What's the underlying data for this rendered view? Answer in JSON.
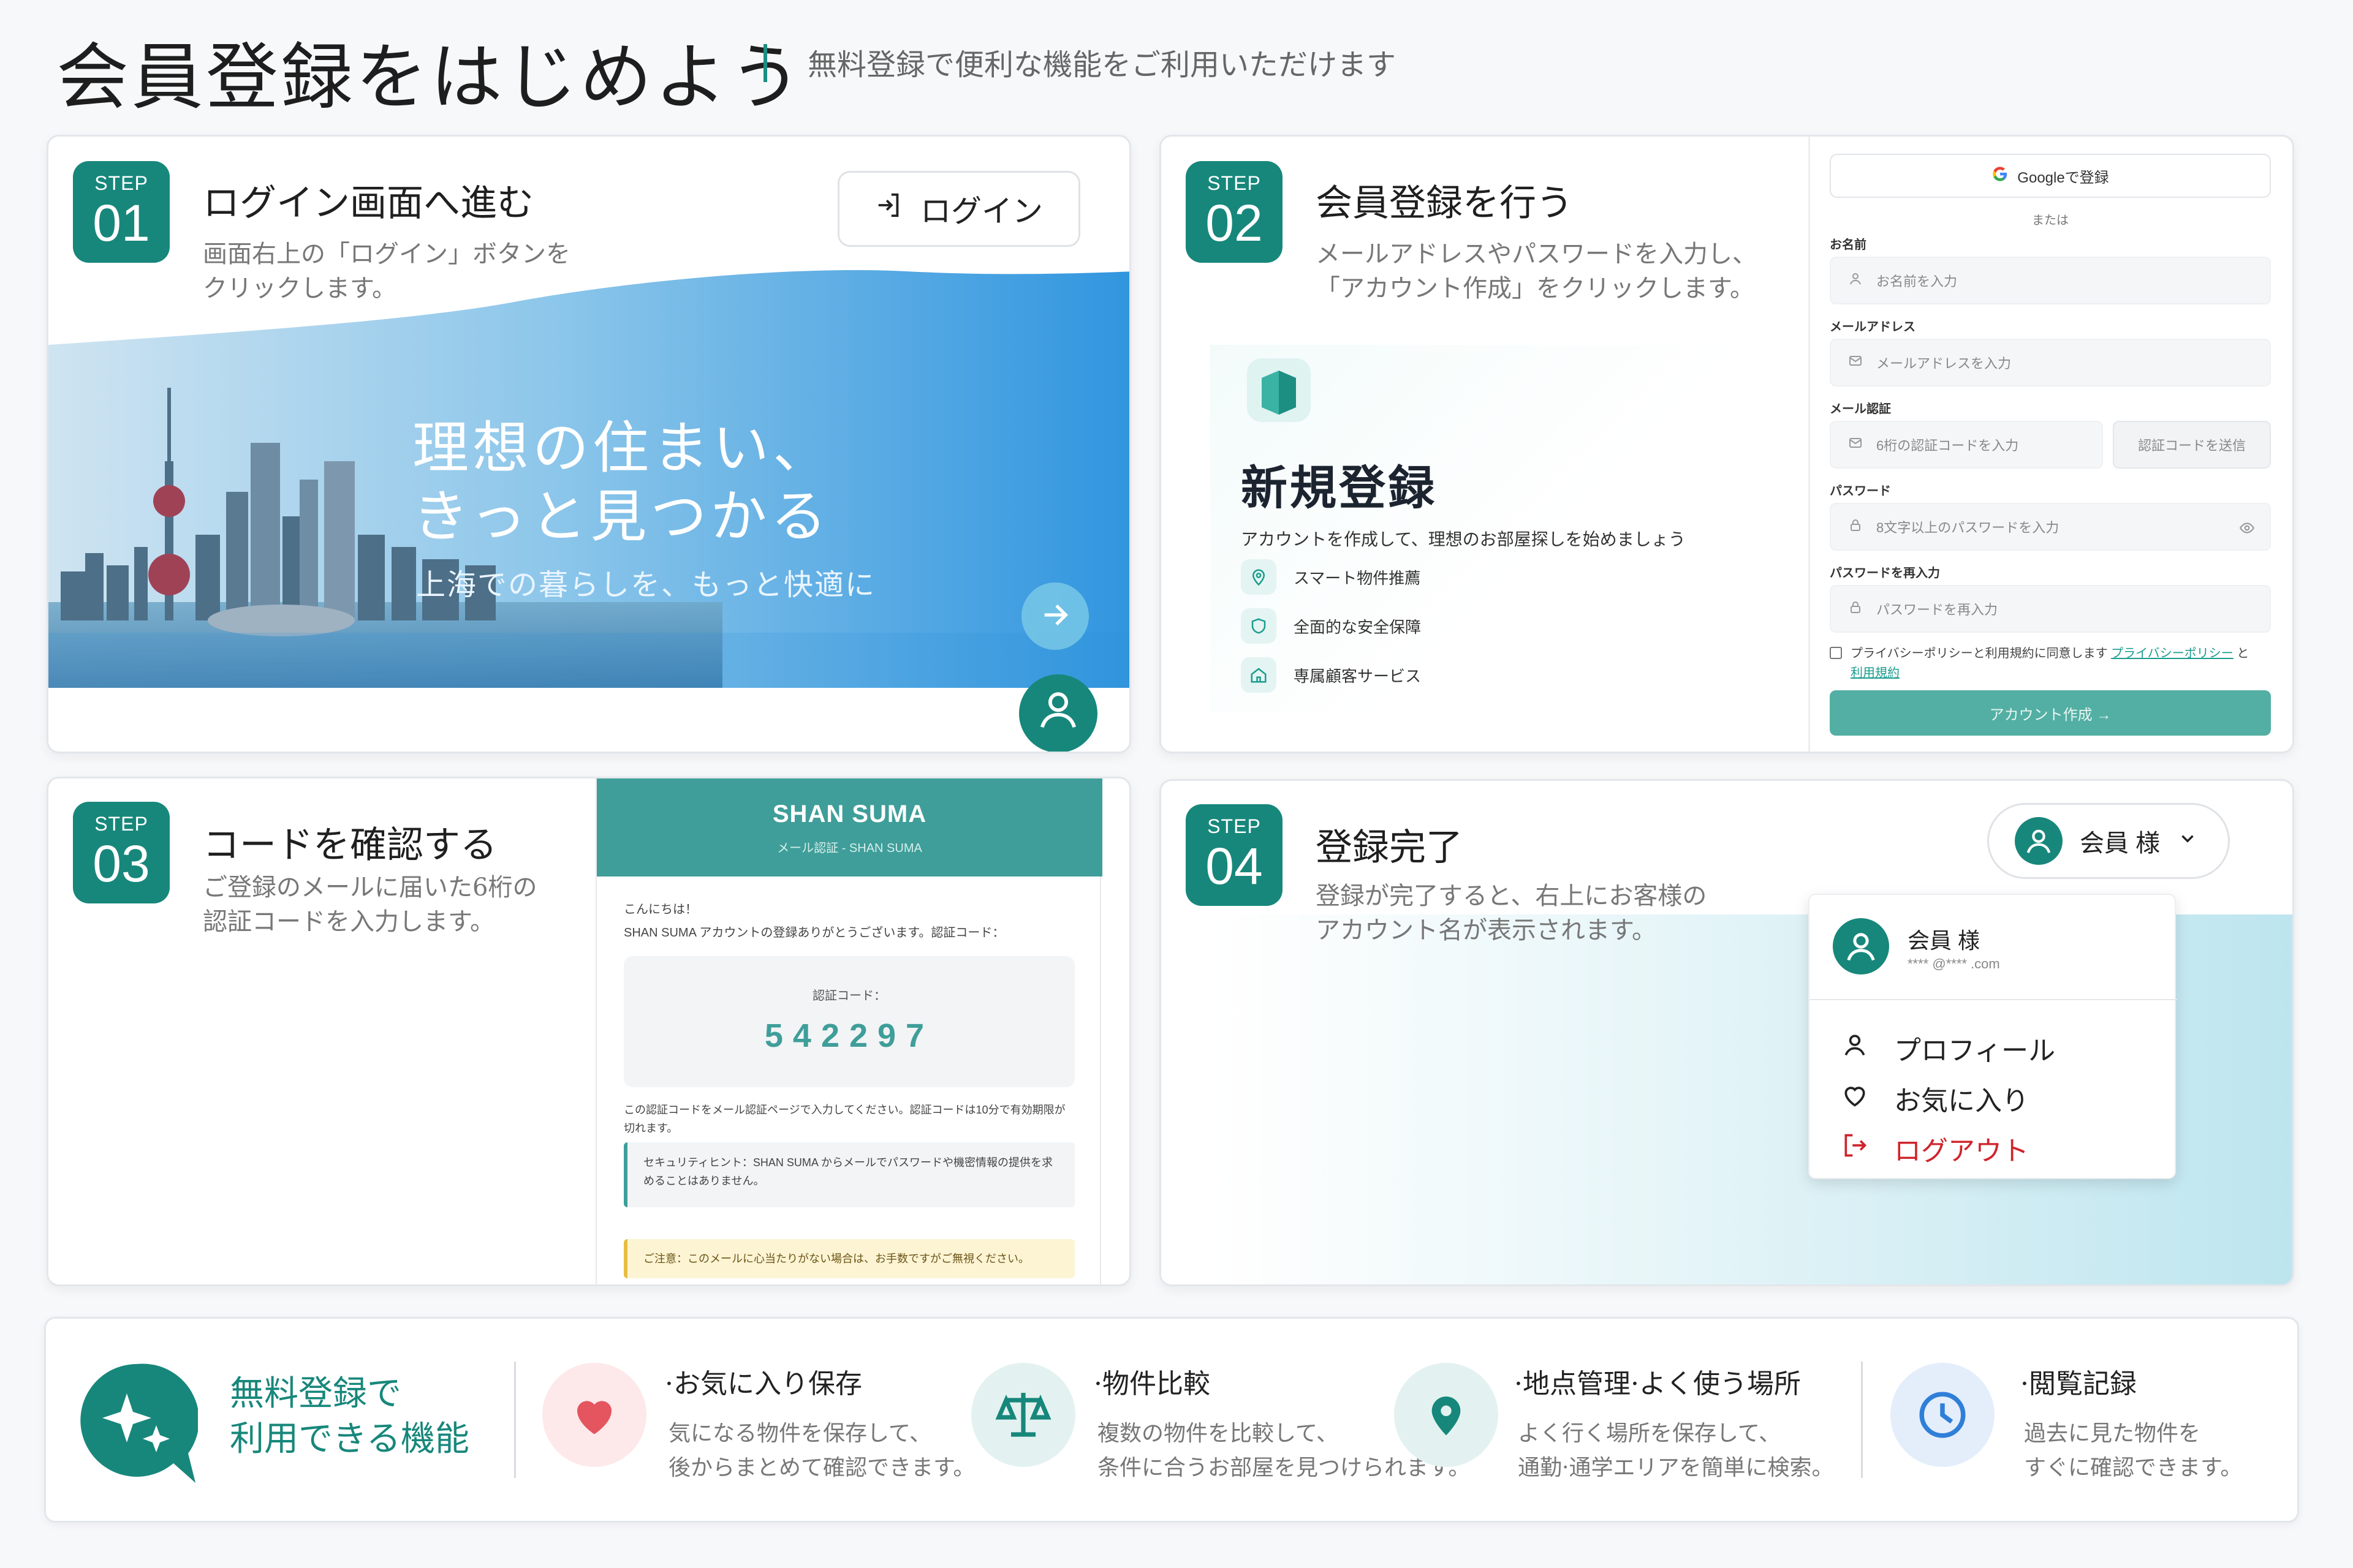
{
  "header": {
    "title": "会員登録をはじめよう",
    "subtitle": "無料登録で便利な機能をご利用いただけます"
  },
  "step_label": "STEP",
  "step1": {
    "num": "01",
    "title": "ログイン画面へ進む",
    "desc": "画面右上の「ログイン」ボタンを\nクリックします。",
    "login_button": "ログイン",
    "banner_title_line1": "理想の住まい、",
    "banner_title_line2": "きっと見つかる",
    "banner_subtitle": "上海での暮らしを、もっと快適に"
  },
  "step2": {
    "num": "02",
    "title": "会員登録を行う",
    "desc": "メールアドレスやパスワードを入力し、\n「アカウント作成」をクリックします。",
    "panel_title": "新規登録",
    "panel_desc": "アカウントを作成して、理想のお部屋探しを始めましょう",
    "features": [
      "スマート物件推薦",
      "全面的な安全保障",
      "専属顧客サービス"
    ],
    "google_button": "Googleで登録",
    "or": "または",
    "name_label": "お名前",
    "name_placeholder": "お名前を入力",
    "email_label": "メールアドレス",
    "email_placeholder": "メールアドレスを入力",
    "verify_label": "メール認証",
    "verify_placeholder": "6桁の認証コードを入力",
    "send_code_button": "認証コードを送信",
    "password_label": "パスワード",
    "password_placeholder": "8文字以上のパスワードを入力",
    "password2_label": "パスワードを再入力",
    "password2_placeholder": "パスワードを再入力",
    "agree_text": "プライバシーポリシーと利用規約に同意します",
    "privacy_link": "プライバシーポリシー",
    "and": "と",
    "terms_link": "利用規約",
    "create_button": "アカウント作成 →"
  },
  "step3": {
    "num": "03",
    "title": "コードを確認する",
    "desc": "ご登録のメールに届いた6桁の\n認証コードを入力します。",
    "brand": "SHAN SUMA",
    "email_subtitle": "メール認証 - SHAN SUMA",
    "greeting": "こんにちは！",
    "thanks": "SHAN SUMA アカウントの登録ありがとうございます。認証コード：",
    "code_label": "認証コード：",
    "code": "542297",
    "instruction": "この認証コードをメール認証ページで入力してください。認証コードは10分で有効期限が切れます。",
    "security_hint": "セキュリティヒント：SHAN SUMA からメールでパスワードや機密情報の提供を求めることはありません。",
    "notice": "ご注意：このメールに心当たりがない場合は、お手数ですがご無視ください。"
  },
  "step4": {
    "num": "04",
    "title": "登録完了",
    "desc": "登録が完了すると、右上にお客様の\nアカウント名が表示されます。",
    "user_label": "会員 様",
    "dropdown_name": "会員 様",
    "dropdown_email": "**** @**** .com",
    "menu": {
      "profile": "プロフィール",
      "favorites": "お気に入り",
      "logout": "ログアウト"
    }
  },
  "features_bar": {
    "headline_line1": "無料登録で",
    "headline_line2": "利用できる機能",
    "items": [
      {
        "title": "·お気に入り保存",
        "desc": "気になる物件を保存して、\n後からまとめて確認できます。"
      },
      {
        "title": "·物件比較",
        "desc": "複数の物件を比較して、\n条件に合うお部屋を見つけられます。"
      },
      {
        "title": "·地点管理·よく使う場所",
        "desc": "よく行く場所を保存して、\n通勤·通学エリアを簡単に検索。"
      },
      {
        "title": "·閲覧記録",
        "desc": "過去に見た物件を\nすぐに確認できます。"
      }
    ]
  },
  "colors": {
    "primary": "#17877b",
    "accent_light": "#53afa3",
    "danger": "#d0242b"
  },
  "icons": {
    "login": "login-icon",
    "arrow": "arrow-right-icon",
    "user": "user-icon",
    "chevron": "chevron-down-icon",
    "heart": "heart-icon",
    "scale": "scale-icon",
    "pin": "location-pin-icon",
    "clock": "clock-icon",
    "sparkle": "sparkle-icon"
  }
}
